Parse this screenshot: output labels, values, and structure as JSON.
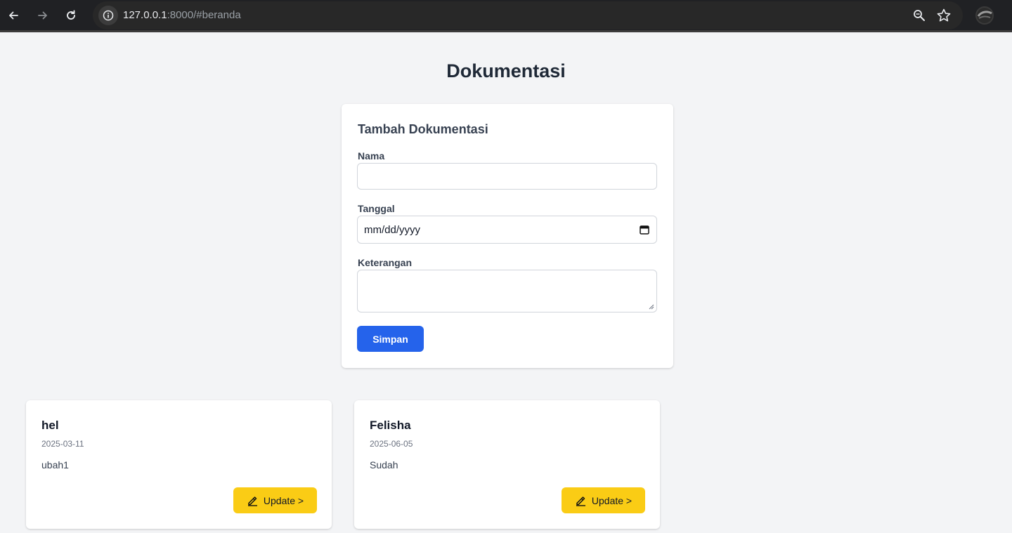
{
  "browser": {
    "url_host": "127.0.0.1",
    "url_rest": ":8000/#beranda"
  },
  "page": {
    "title": "Dokumentasi"
  },
  "form": {
    "title": "Tambah Dokumentasi",
    "nama_label": "Nama",
    "nama_value": "",
    "tanggal_label": "Tanggal",
    "tanggal_placeholder": "mm/dd/yyyy",
    "keterangan_label": "Keterangan",
    "keterangan_value": "",
    "submit_label": "Simpan",
    "submit_color": "#2563eb"
  },
  "cards": [
    {
      "name": "hel",
      "date": "2025-03-11",
      "description": "ubah1",
      "button_label": "Update >",
      "button_icon": "pencil-icon"
    },
    {
      "name": "Felisha",
      "date": "2025-06-05",
      "description": "Sudah",
      "button_label": "Update >",
      "button_icon": "pencil-icon"
    }
  ],
  "colors": {
    "background": "#f3f4f6",
    "update_button": "#facc15"
  }
}
